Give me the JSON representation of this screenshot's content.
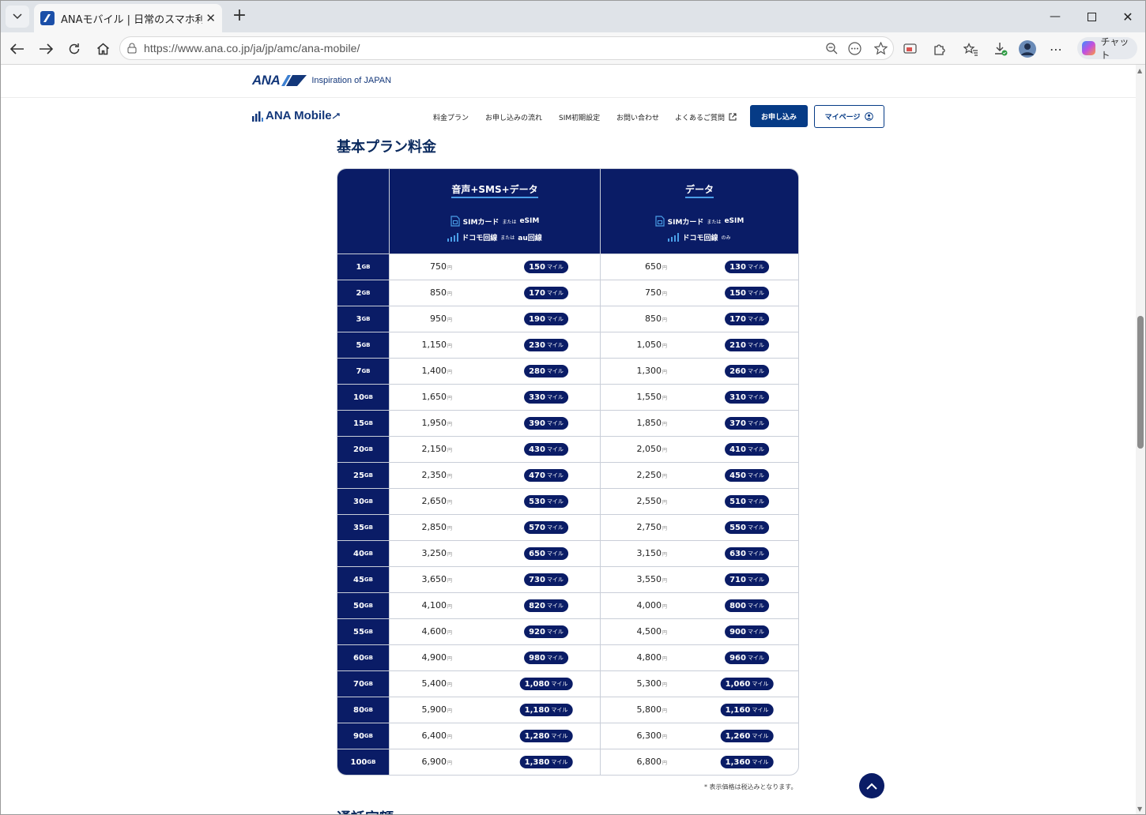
{
  "browser": {
    "tab_title": "ANAモバイル | 日常のスマホ利用でマイ",
    "url": "https://www.ana.co.jp/ja/jp/amc/ana-mobile/",
    "chat_label": "チャット"
  },
  "header": {
    "ana_logo": "ANA",
    "tagline": "Inspiration of JAPAN",
    "mobile_logo": "ANA Mobile",
    "nav": [
      "料金プラン",
      "お申し込みの流れ",
      "SIM初期設定",
      "お問い合わせ",
      "よくあるご質問"
    ],
    "apply_label": "お申し込み",
    "mypage_label": "マイページ"
  },
  "section_title": "基本プラン料金",
  "table": {
    "plans": [
      {
        "name": "音声+SMS+データ",
        "line1": {
          "a": "SIMカード",
          "s": "または",
          "b": "eSIM"
        },
        "line2": {
          "a": "ドコモ回線",
          "s": "または",
          "b": "au回線"
        }
      },
      {
        "name": "データ",
        "line1": {
          "a": "SIMカード",
          "s": "または",
          "b": "eSIM"
        },
        "line2": {
          "a": "ドコモ回線",
          "s": "のみ",
          "b": ""
        }
      }
    ],
    "yen_unit": "円",
    "mile_unit": "マイル",
    "gb_unit": "GB",
    "rows": [
      {
        "gb": "1",
        "p1": "750",
        "m1": "150",
        "p2": "650",
        "m2": "130"
      },
      {
        "gb": "2",
        "p1": "850",
        "m1": "170",
        "p2": "750",
        "m2": "150"
      },
      {
        "gb": "3",
        "p1": "950",
        "m1": "190",
        "p2": "850",
        "m2": "170"
      },
      {
        "gb": "5",
        "p1": "1,150",
        "m1": "230",
        "p2": "1,050",
        "m2": "210"
      },
      {
        "gb": "7",
        "p1": "1,400",
        "m1": "280",
        "p2": "1,300",
        "m2": "260"
      },
      {
        "gb": "10",
        "p1": "1,650",
        "m1": "330",
        "p2": "1,550",
        "m2": "310"
      },
      {
        "gb": "15",
        "p1": "1,950",
        "m1": "390",
        "p2": "1,850",
        "m2": "370"
      },
      {
        "gb": "20",
        "p1": "2,150",
        "m1": "430",
        "p2": "2,050",
        "m2": "410"
      },
      {
        "gb": "25",
        "p1": "2,350",
        "m1": "470",
        "p2": "2,250",
        "m2": "450"
      },
      {
        "gb": "30",
        "p1": "2,650",
        "m1": "530",
        "p2": "2,550",
        "m2": "510"
      },
      {
        "gb": "35",
        "p1": "2,850",
        "m1": "570",
        "p2": "2,750",
        "m2": "550"
      },
      {
        "gb": "40",
        "p1": "3,250",
        "m1": "650",
        "p2": "3,150",
        "m2": "630"
      },
      {
        "gb": "45",
        "p1": "3,650",
        "m1": "730",
        "p2": "3,550",
        "m2": "710"
      },
      {
        "gb": "50",
        "p1": "4,100",
        "m1": "820",
        "p2": "4,000",
        "m2": "800"
      },
      {
        "gb": "55",
        "p1": "4,600",
        "m1": "920",
        "p2": "4,500",
        "m2": "900"
      },
      {
        "gb": "60",
        "p1": "4,900",
        "m1": "980",
        "p2": "4,800",
        "m2": "960"
      },
      {
        "gb": "70",
        "p1": "5,400",
        "m1": "1,080",
        "p2": "5,300",
        "m2": "1,060"
      },
      {
        "gb": "80",
        "p1": "5,900",
        "m1": "1,180",
        "p2": "5,800",
        "m2": "1,160"
      },
      {
        "gb": "90",
        "p1": "6,400",
        "m1": "1,280",
        "p2": "6,300",
        "m2": "1,260"
      },
      {
        "gb": "100",
        "p1": "6,900",
        "m1": "1,380",
        "p2": "6,800",
        "m2": "1,360"
      }
    ]
  },
  "note": "* 表示価格は税込みとなります。",
  "next_section_title": "通話定額",
  "colors": {
    "navy": "#0a1c66",
    "accent": "#4a9ee8",
    "button": "#063b86"
  }
}
